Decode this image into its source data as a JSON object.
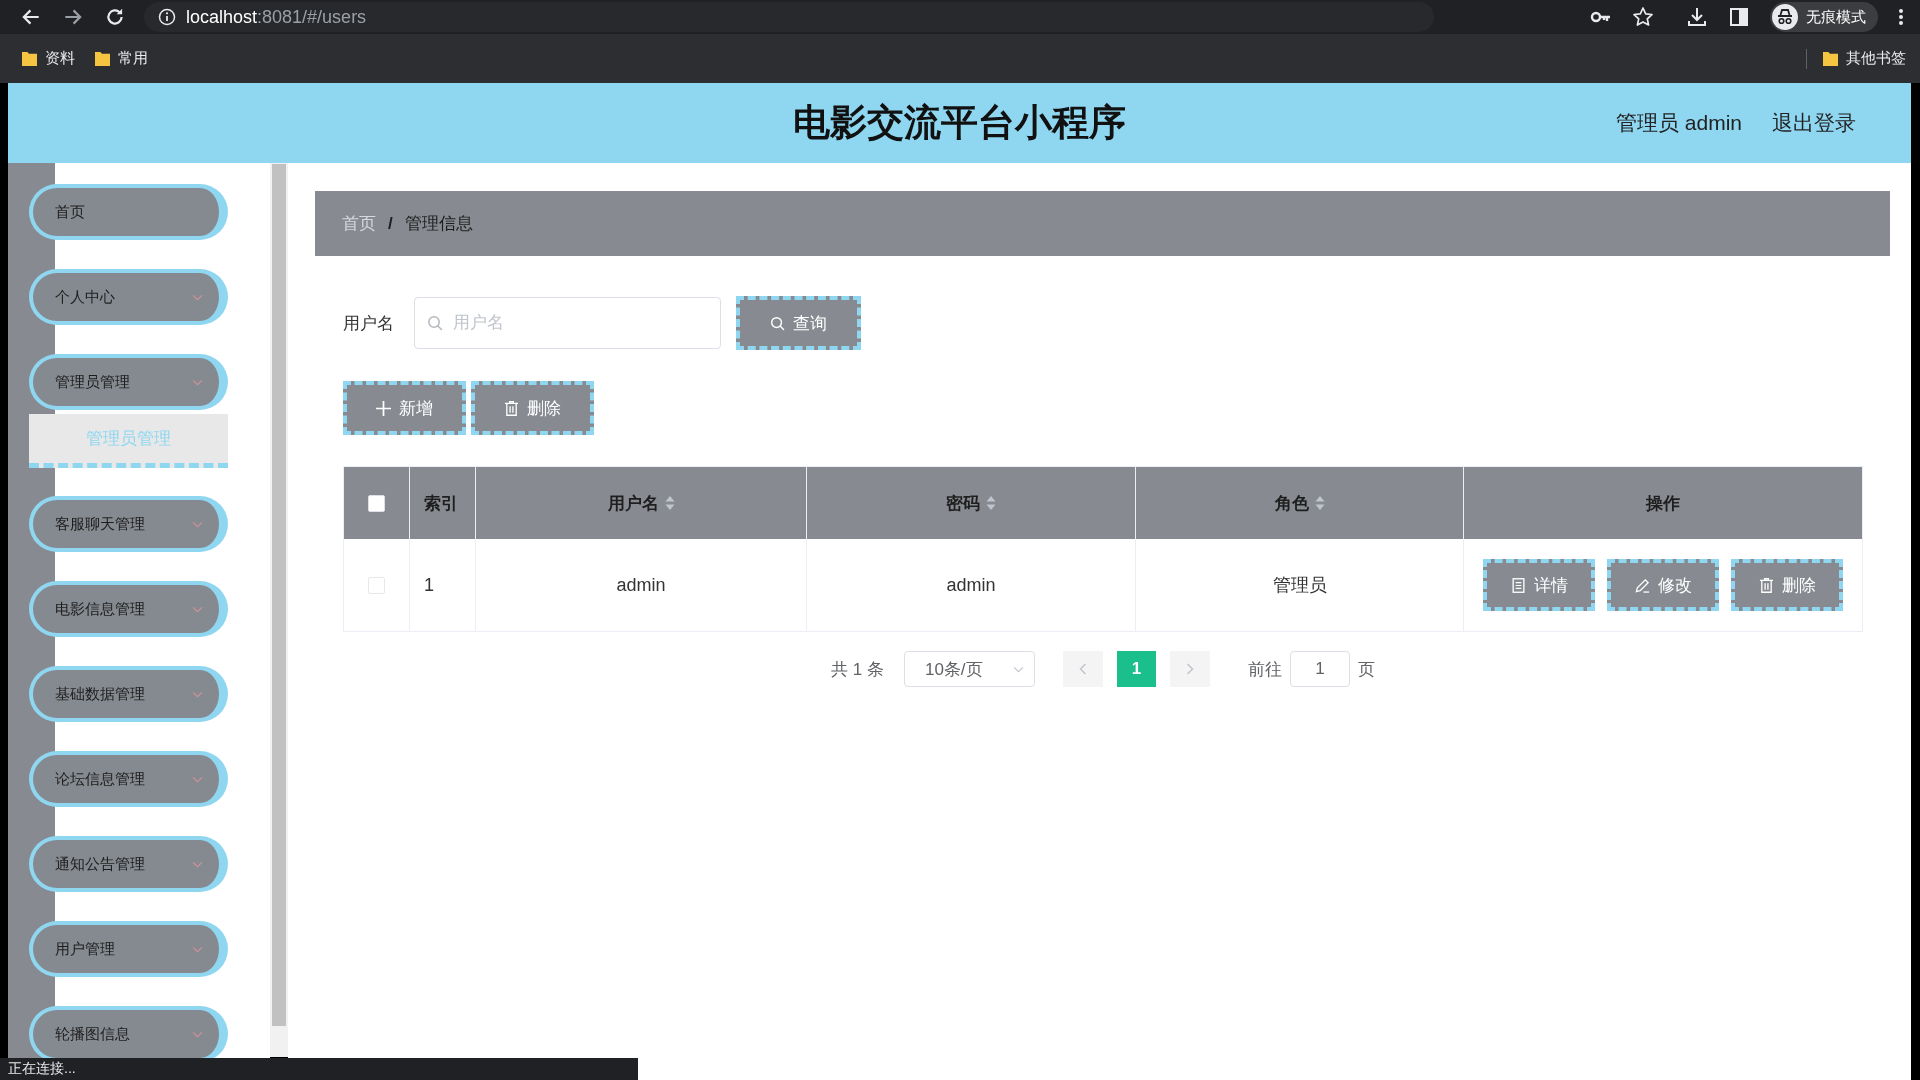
{
  "browser": {
    "url": {
      "host": "localhost",
      "path": ":8081/#/users"
    },
    "profile": "无痕模式",
    "bookmarks": [
      "资料",
      "常用"
    ],
    "other_bookmarks": "其他书签"
  },
  "header": {
    "title": "电影交流平台小程序",
    "user": "管理员 admin",
    "logout": "退出登录"
  },
  "sidebar": {
    "items": [
      {
        "label": "首页",
        "kind": "link"
      },
      {
        "label": "个人中心",
        "kind": "submenu"
      },
      {
        "label": "管理员管理",
        "kind": "submenu",
        "children": [
          {
            "label": "管理员管理"
          }
        ]
      },
      {
        "label": "客服聊天管理",
        "kind": "submenu"
      },
      {
        "label": "电影信息管理",
        "kind": "submenu"
      },
      {
        "label": "基础数据管理",
        "kind": "submenu"
      },
      {
        "label": "论坛信息管理",
        "kind": "submenu"
      },
      {
        "label": "通知公告管理",
        "kind": "submenu"
      },
      {
        "label": "用户管理",
        "kind": "submenu"
      },
      {
        "label": "轮播图信息",
        "kind": "submenu"
      }
    ]
  },
  "breadcrumb": {
    "items": [
      "首页",
      "管理信息"
    ],
    "separator": "/"
  },
  "search": {
    "label": "用户名",
    "placeholder": "用户名",
    "button": "查询"
  },
  "actions": [
    {
      "label": "新增",
      "kind": "add"
    },
    {
      "label": "删除",
      "kind": "delete"
    }
  ],
  "table": {
    "select_all": {
      "checked": false
    },
    "columns": [
      {
        "label": "索引",
        "sortable": false
      },
      {
        "label": "用户名",
        "sortable": true
      },
      {
        "label": "密码",
        "sortable": true
      },
      {
        "label": "角色",
        "sortable": true
      },
      {
        "label": "操作",
        "sortable": false
      }
    ],
    "rows": [
      {
        "checked": false,
        "cells": [
          "1",
          "admin",
          "admin",
          "管理员"
        ],
        "actions": [
          {
            "label": "详情",
            "kind": "detail"
          },
          {
            "label": "修改",
            "kind": "edit"
          },
          {
            "label": "删除",
            "kind": "delete"
          }
        ]
      }
    ]
  },
  "pagination": {
    "total": "共 1 条",
    "page_size": "10条/页",
    "pages": [
      {
        "label": "1",
        "selected": true
      }
    ],
    "goto_label": "前往",
    "goto_value": "1",
    "goto_suffix": "页"
  },
  "status_bar": "正在连接..."
}
